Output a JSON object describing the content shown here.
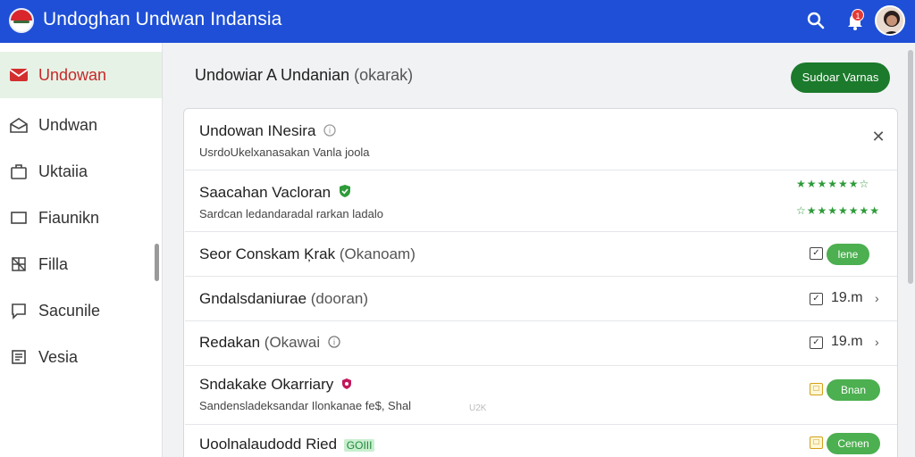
{
  "header": {
    "title": "Undoghan Undwan Indansia",
    "notification_count": "1",
    "icons": [
      "flag-logo-icon",
      "search-icon",
      "bell-icon",
      "avatar"
    ]
  },
  "sidebar": {
    "items": [
      {
        "label": "Undowan",
        "icon": "mail-red-icon",
        "active": true
      },
      {
        "label": "Undwan",
        "icon": "envelope-open-icon",
        "active": false
      },
      {
        "label": "Uktaiia",
        "icon": "bag-icon",
        "active": false
      },
      {
        "label": "Fiaunikn",
        "icon": "card-icon",
        "active": false
      },
      {
        "label": "Filla",
        "icon": "grid-icon",
        "active": false
      },
      {
        "label": "Sacunile",
        "icon": "comment-icon",
        "active": false
      },
      {
        "label": "Vesia",
        "icon": "document-icon",
        "active": false
      }
    ]
  },
  "main": {
    "title": "Undowiar A Undanian",
    "title_sub": "(okarak)",
    "action_button": "Sudoar Varnas"
  },
  "rows": [
    {
      "title": "Undowan INesira",
      "subtitle": "UsrdoUkelxanasakan Vanla joola",
      "has_close": true
    },
    {
      "title": "Saacahan Vacloran",
      "subtitle": "Sardcan ledandaradal rarkan ladalo",
      "stars_top": "★★★★★★☆",
      "stars_bottom": "☆★★★★★★★"
    },
    {
      "title": "Seor Conskam Ķrak",
      "title_sub": "(Okanoam)",
      "pill": "lene"
    },
    {
      "title": "Gndalsdaniurae",
      "title_sub": "(dooran)",
      "time": "19.m"
    },
    {
      "title": "Redakan",
      "title_sub": "(Okawai",
      "time": "19.m"
    },
    {
      "title": "Sndakake Okarriary",
      "subtitle": "Sandensladeksandar Ilonkanae fe$, Shal",
      "ghost": "U2K",
      "pill": "Bnan"
    },
    {
      "title": "Uoolnalaudodd Ried",
      "tag": "GOIII",
      "pill": "Cenen"
    }
  ],
  "colors": {
    "header_bg": "#1e4fd6",
    "active_bg": "#e6f2e6",
    "primary_button": "#1b7a2b",
    "pill_green": "#4caf50",
    "star_green": "#2e9b3a"
  }
}
